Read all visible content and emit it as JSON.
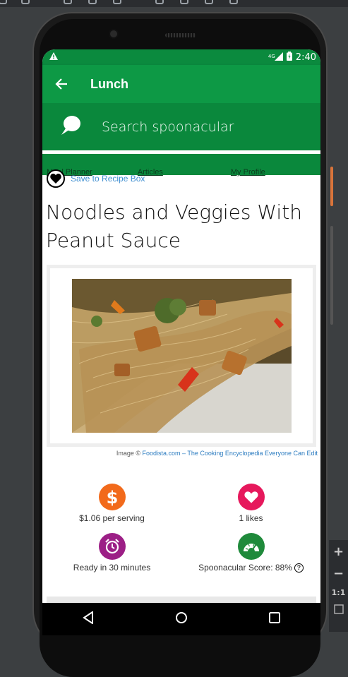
{
  "status": {
    "time": "2:40",
    "network": "4G"
  },
  "appbar": {
    "title": "Lunch"
  },
  "search": {
    "placeholder": "Search spoonacular"
  },
  "nav": {
    "links": [
      "Meal Planner",
      "Articles",
      "My Profile"
    ]
  },
  "recipe": {
    "save_label": "Save to Recipe Box",
    "title": "Noodles and Veggies With Peanut Sauce",
    "credit_prefix": "Image ©",
    "credit_link": "Foodista.com – The Cooking Encyclopedia Everyone Can Edit"
  },
  "stats": {
    "price": "$1.06 per serving",
    "likes": "1 likes",
    "ready": "Ready in 30 minutes",
    "score": "Spoonacular Score: 88%"
  },
  "colors": {
    "status_green": "#0b8a3e",
    "appbar_green": "#0d9945",
    "price_orange": "#f26a1b",
    "likes_pink": "#e6185c",
    "time_purple": "#9c1f86",
    "score_green": "#1f8a3b"
  }
}
